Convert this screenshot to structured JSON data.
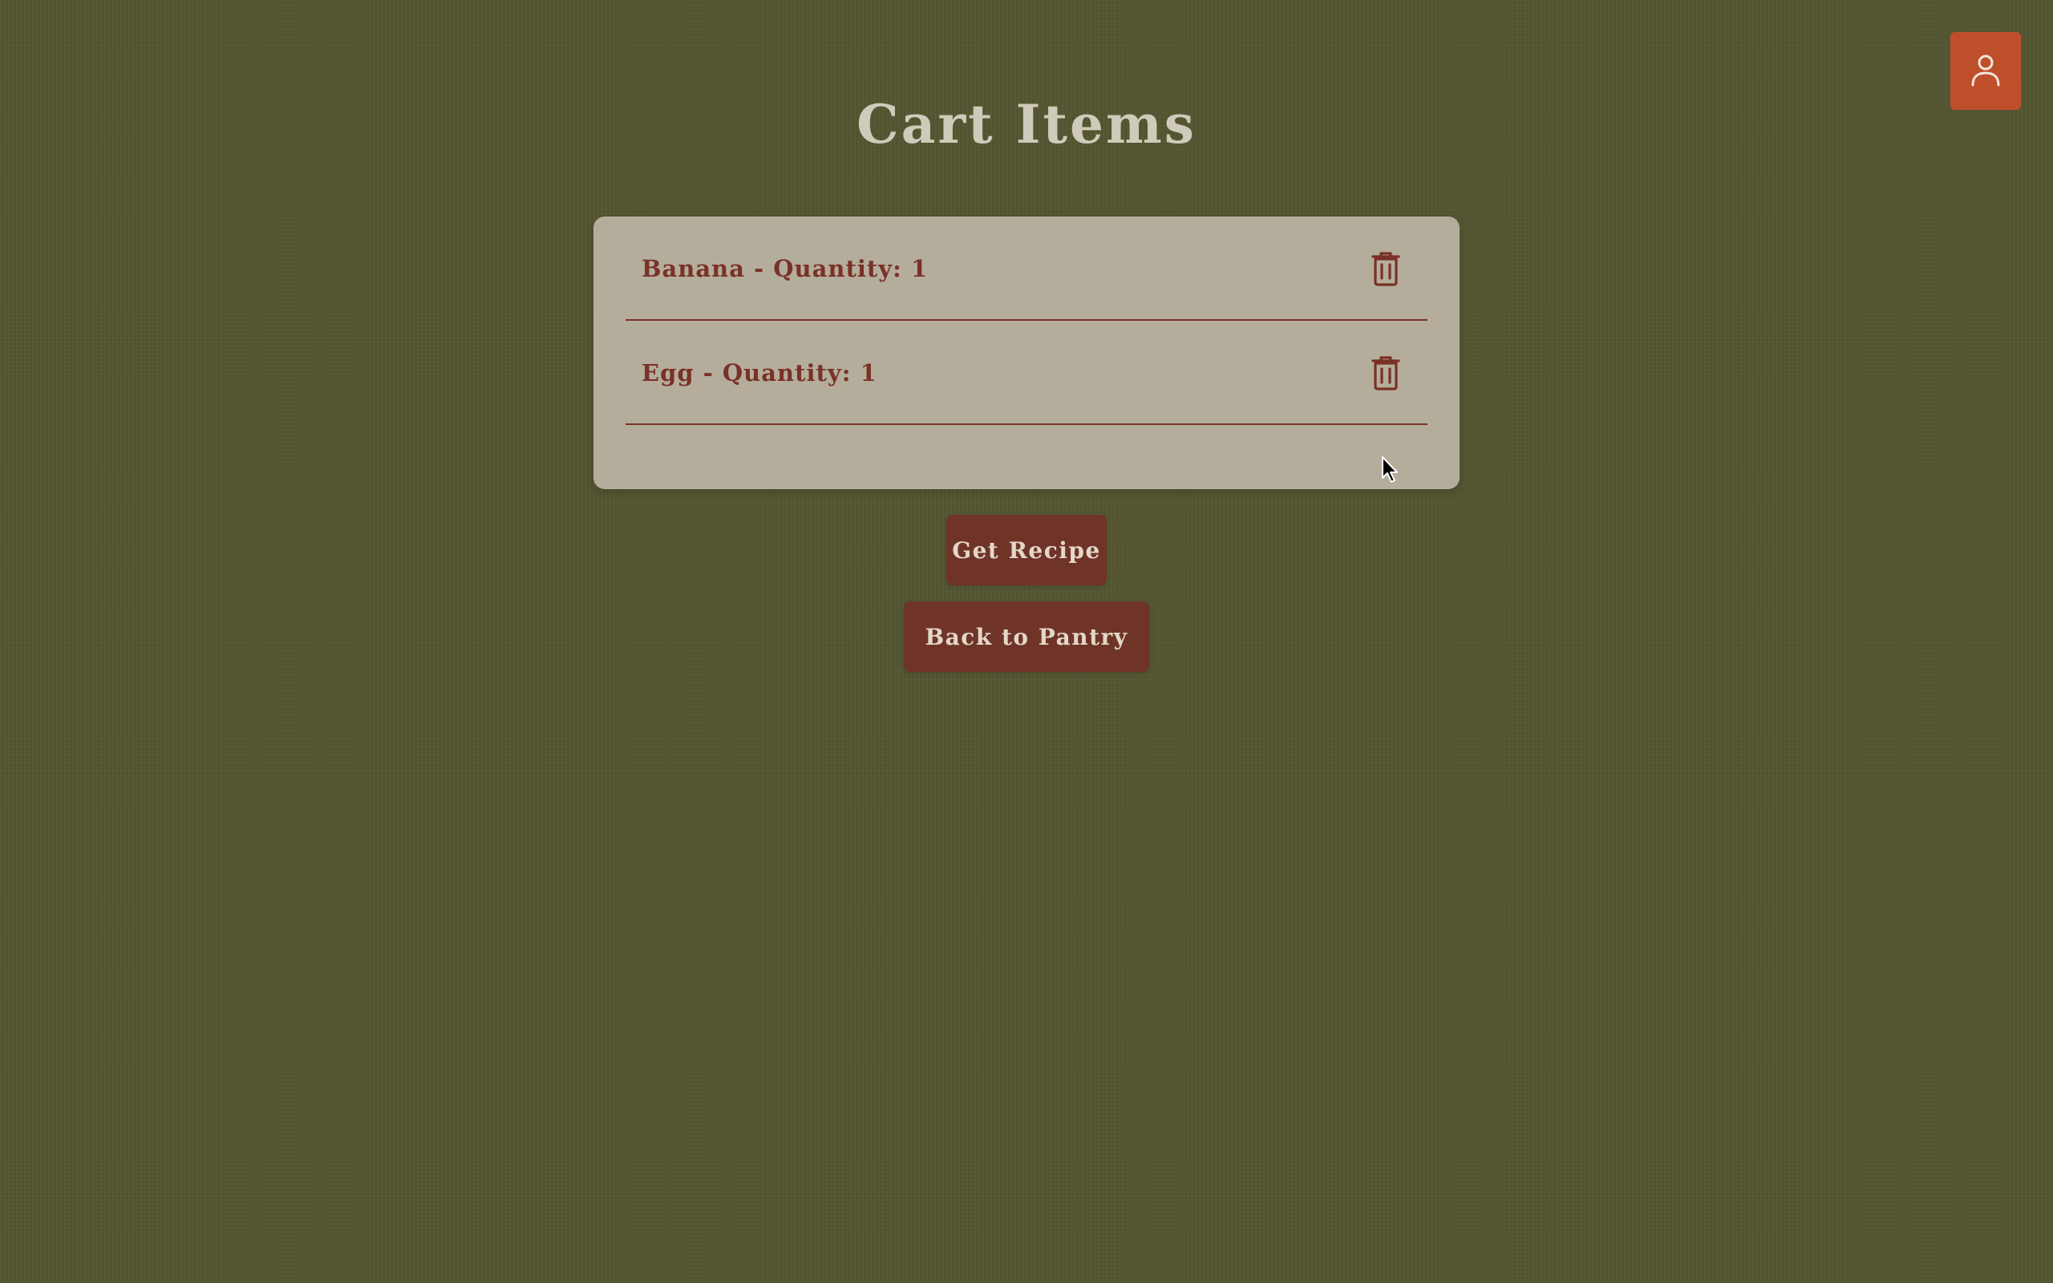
{
  "page": {
    "title": "Cart Items"
  },
  "header": {
    "profile_icon": "user-icon"
  },
  "cart": {
    "items": [
      {
        "label": "Banana - Quantity: 1",
        "delete_icon": "trash-icon"
      },
      {
        "label": "Egg - Quantity: 1",
        "delete_icon": "trash-icon"
      }
    ]
  },
  "actions": {
    "get_recipe_label": "Get Recipe",
    "back_label": "Back to Pantry"
  },
  "colors": {
    "background": "#545632",
    "panel": "#b4ad9c",
    "accent": "#7a3126",
    "button": "#6f3427",
    "profile_button": "#bf4f2a",
    "title": "#cfcab9"
  }
}
